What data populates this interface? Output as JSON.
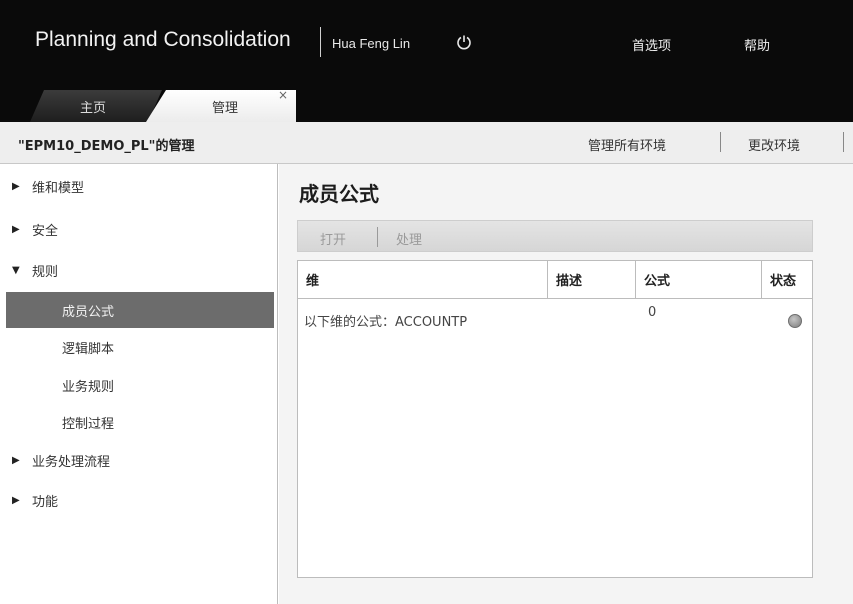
{
  "header": {
    "app_title": "Planning and Consolidation",
    "user_name": "Hua Feng Lin",
    "preferences": "首选项",
    "help": "帮助"
  },
  "tabs": [
    {
      "label": "主页"
    },
    {
      "label": "管理"
    }
  ],
  "tab_close": "×",
  "subheader": {
    "title": "\"EPM10_DEMO_PL\"的管理",
    "manage_all": "管理所有环境",
    "change_env": "更改环境"
  },
  "sidebar": {
    "items": [
      {
        "label": "维和模型",
        "arrow": "▶"
      },
      {
        "label": "安全",
        "arrow": "▶"
      },
      {
        "label": "规则",
        "arrow": "▼"
      },
      {
        "label": "成员公式"
      },
      {
        "label": "逻辑脚本"
      },
      {
        "label": "业务规则"
      },
      {
        "label": "控制过程"
      },
      {
        "label": "业务处理流程",
        "arrow": "▶"
      },
      {
        "label": "功能",
        "arrow": "▶"
      }
    ]
  },
  "main": {
    "title": "成员公式",
    "toolbar": {
      "open": "打开",
      "process": "处理"
    },
    "table": {
      "columns": [
        "维",
        "描述",
        "公式",
        "状态"
      ],
      "rows": [
        {
          "dimension": "以下维的公式：ACCOUNTP",
          "description": "",
          "formula": "0",
          "status": "gray"
        }
      ]
    }
  },
  "colors": {
    "header_bg": "#0a0a0a",
    "active_nav": "#6c6c6c",
    "status_gray": "#9a9a9a"
  }
}
